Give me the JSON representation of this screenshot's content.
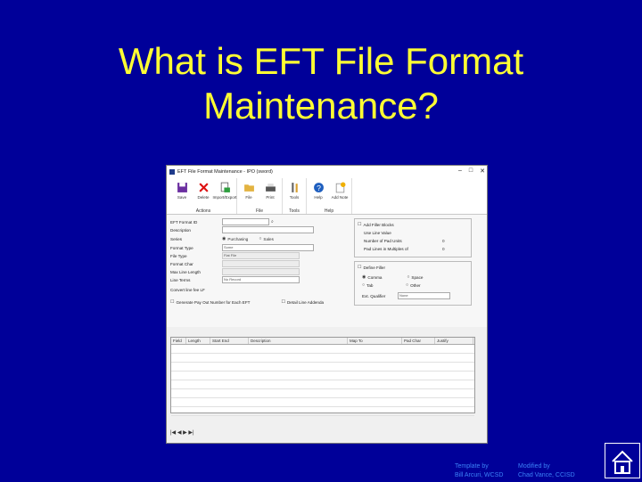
{
  "slide": {
    "title_line1": "What is EFT File Format",
    "title_line2": "Maintenance?",
    "credits": {
      "template_label": "Template by",
      "template_author": "Bill Arcuri, WCSD",
      "modified_label": "Modified by",
      "modified_author": "Chad Vance, CCISD"
    }
  },
  "window": {
    "title": "EFT File Format Maintenance - IPO (sword)",
    "ribbon": {
      "groups": [
        {
          "label": "Actions",
          "buttons": [
            {
              "label": "Save",
              "icon": "save-icon"
            },
            {
              "label": "Delete",
              "icon": "delete-icon"
            },
            {
              "label": "Import/Export",
              "icon": "import-export-icon"
            }
          ]
        },
        {
          "label": "File",
          "buttons": [
            {
              "label": "File",
              "icon": "folder-icon"
            },
            {
              "label": "Print",
              "icon": "print-icon"
            }
          ]
        },
        {
          "label": "Tools",
          "buttons": [
            {
              "label": "Tools",
              "icon": "tools-icon"
            }
          ]
        },
        {
          "label": "Help",
          "buttons": [
            {
              "label": "Help",
              "icon": "help-icon"
            },
            {
              "label": "Add Note",
              "icon": "note-icon"
            }
          ]
        }
      ]
    },
    "form": {
      "eft_format_id_label": "EFT Format ID",
      "description_label": "Description",
      "series_label": "Series",
      "series_purchasing": "Purchasing",
      "series_sales": "Sales",
      "format_type_label": "Format Type",
      "format_type_value": "Some",
      "file_type_label": "File Type",
      "file_type_value": "Flat File",
      "format_char_label": "Format Char",
      "max_line_length_label": "Max Line Length",
      "line_terms_label": "Line Terms",
      "line_terms_value": "No Record",
      "convert_label": "Convert line fee LF",
      "generate_label": "Generate Pay Out Number for Each EFT",
      "detail_label": "Detail Line Addenda",
      "add_filler_label": "Add Filler Blocks",
      "use_line_label": "Use Line Value",
      "number_pad_label": "Number of Pad Units",
      "number_pad_value": "0",
      "pad_lines_label": "Pad Lines in Multiples of",
      "pad_lines_value": "0",
      "define_filler_label": "Define Filler",
      "comma_label": "Comma",
      "space_label": "Space",
      "tab_label": "Tab",
      "other_label": "Other",
      "ext_qualifier_label": "Ext. Qualifier",
      "ext_qualifier_value": "None"
    },
    "grid": {
      "columns": [
        "Field",
        "Length",
        "Start End",
        "Description",
        "Map To",
        "Pad Char",
        "Justify"
      ],
      "row_count": 8
    },
    "nav": "|◀ ◀ ▶ ▶|"
  },
  "colors": {
    "background": "#000099",
    "title": "#ffff33",
    "credit": "#3b82f6"
  }
}
